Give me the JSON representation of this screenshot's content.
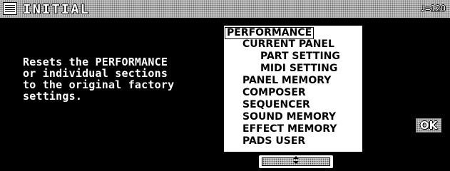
{
  "header": {
    "logo_icon": "performance-memory-icon",
    "title": "INITIAL",
    "tempo": "♩=120"
  },
  "description": "Resets the PERFORMANCE\nor individual sections\nto the original factory\nsettings.",
  "list": {
    "items": [
      {
        "label": "PERFORMANCE",
        "level": 0,
        "selected": true
      },
      {
        "label": "CURRENT PANEL",
        "level": 1,
        "selected": false
      },
      {
        "label": "PART SETTING",
        "level": 2,
        "selected": false
      },
      {
        "label": "MIDI SETTING",
        "level": 2,
        "selected": false
      },
      {
        "label": "PANEL MEMORY",
        "level": 1,
        "selected": false
      },
      {
        "label": "COMPOSER",
        "level": 1,
        "selected": false
      },
      {
        "label": "SEQUENCER",
        "level": 1,
        "selected": false
      },
      {
        "label": "SOUND MEMORY",
        "level": 1,
        "selected": false
      },
      {
        "label": "EFFECT MEMORY",
        "level": 1,
        "selected": false
      },
      {
        "label": "PADS USER",
        "level": 1,
        "selected": false
      }
    ]
  },
  "scroll": {
    "icon": "up-down-arrow-icon"
  },
  "ok_label": "OK"
}
